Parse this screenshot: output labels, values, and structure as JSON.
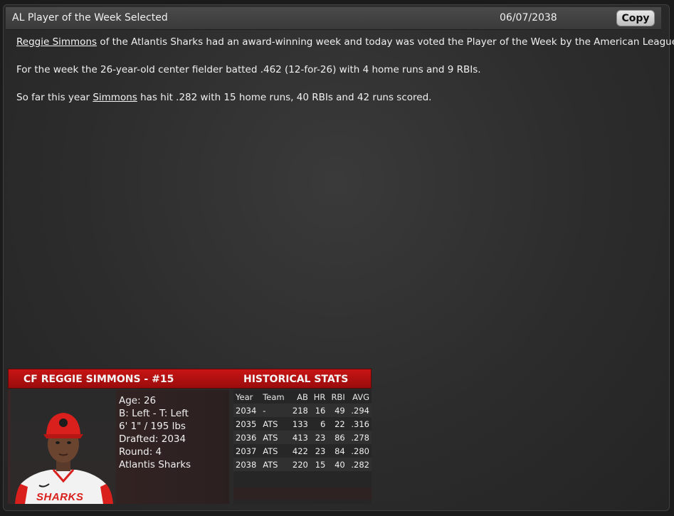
{
  "window": {
    "title": "AL Player of the Week Selected",
    "date": "06/07/2038",
    "copy_label": "Copy"
  },
  "article": {
    "p1": {
      "link": "Reggie Simmons",
      "text": " of the Atlantis Sharks had an award-winning week and today was voted the Player of the Week by the American League."
    },
    "p2": "For the week the 26-year-old center fielder batted .462 (12-for-26) with 4 home runs and 9 RBIs.",
    "p3": {
      "before": "So far this year ",
      "link": "Simmons",
      "after": " has hit .282 with 15 home runs, 40 RBIs and 42 runs scored."
    }
  },
  "card": {
    "name": "CF REGGIE SIMMONS - #15",
    "hist_title": "HISTORICAL STATS",
    "bio": {
      "age": "Age: 26",
      "bats_throws": "B: Left - T: Left",
      "size": "6' 1\" / 195 lbs",
      "drafted": "Drafted: 2034",
      "round": "Round: 4",
      "team": "Atlantis Sharks"
    },
    "jersey_text": "SHARKS",
    "colors": {
      "header_red": "#c81414",
      "cap_red": "#d9201c"
    }
  },
  "stats": {
    "headers": [
      "Year",
      "Team",
      "AB",
      "HR",
      "RBI",
      "AVG"
    ],
    "rows": [
      [
        "2034",
        "-",
        "218",
        "16",
        "49",
        ".294"
      ],
      [
        "2035",
        "ATS",
        "133",
        "6",
        "22",
        ".316"
      ],
      [
        "2036",
        "ATS",
        "413",
        "23",
        "86",
        ".278"
      ],
      [
        "2037",
        "ATS",
        "422",
        "23",
        "84",
        ".280"
      ],
      [
        "2038",
        "ATS",
        "220",
        "15",
        "40",
        ".282"
      ]
    ]
  }
}
